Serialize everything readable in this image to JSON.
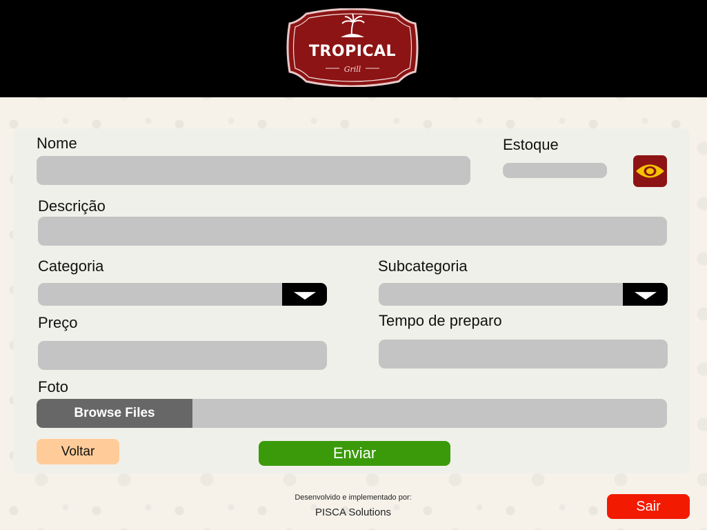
{
  "header": {
    "logo_title": "TROPICAL",
    "logo_subtitle": "Grill"
  },
  "form": {
    "nome_label": "Nome",
    "nome_value": "",
    "estoque_label": "Estoque",
    "estoque_value": "",
    "visibility_icon": "eye-icon",
    "descricao_label": "Descrição",
    "descricao_value": "",
    "categoria_label": "Categoria",
    "categoria_value": "",
    "subcategoria_label": "Subcategoria",
    "subcategoria_value": "",
    "preco_label": "Preço",
    "preco_value": "",
    "tempo_label": "Tempo de preparo",
    "tempo_value": "",
    "foto_label": "Foto",
    "browse_label": "Browse Files",
    "voltar_label": "Voltar",
    "enviar_label": "Enviar"
  },
  "footer": {
    "caption": "Desenvolvido e implementado por:",
    "company": "PISCA Solutions",
    "sair_label": "Sair"
  },
  "colors": {
    "header_bg": "#000000",
    "logo_red": "#8d1414",
    "eye_yellow": "#f4c400",
    "enviar_green": "#3a9a0a",
    "voltar_peach": "#ffcc99",
    "sair_red": "#f21a00",
    "field_gray": "#c4c4c4"
  }
}
